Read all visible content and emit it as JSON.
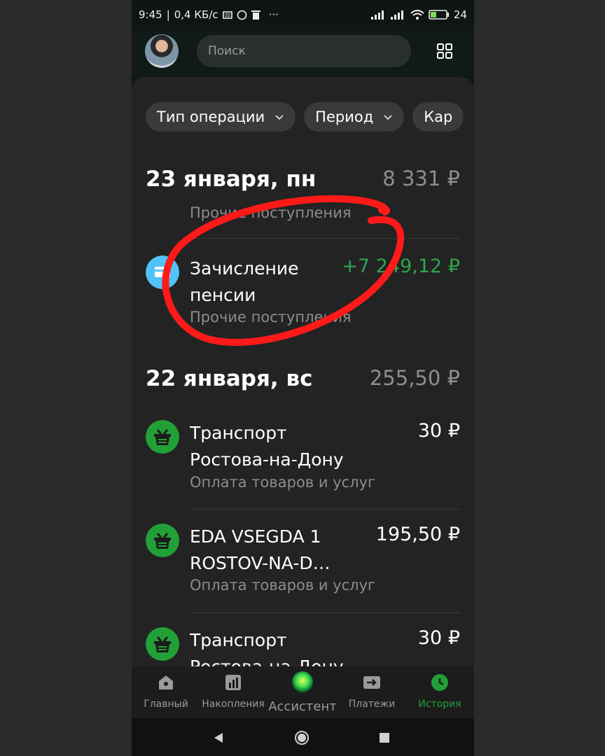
{
  "status_bar": {
    "time": "9:45",
    "speed": "0,4 КБ/с",
    "more": "···",
    "battery": "24"
  },
  "search": {
    "placeholder": "Поиск"
  },
  "filters": [
    "Тип операции",
    "Период",
    "Кар"
  ],
  "days": [
    {
      "title": "23 января, пн",
      "sum": "8 331 ₽",
      "truncated_category": "Прочие поступления",
      "transactions": [
        {
          "name": "Зачисление пенсии",
          "amount": "+7 249,12 ₽",
          "category": "Прочие поступления",
          "icon": "card-icon"
        }
      ]
    },
    {
      "title": "22 января, вс",
      "sum": "255,50 ₽",
      "transactions": [
        {
          "name": "Транспорт Ростова-на-Дону",
          "amount": "30 ₽",
          "category": "Оплата товаров и услуг",
          "icon": "basket-icon"
        },
        {
          "name": "EDA VSEGDA 1 ROSTOV-NA-D…",
          "amount": "195,50 ₽",
          "category": "Оплата товаров и услуг",
          "icon": "basket-icon"
        },
        {
          "name": "Транспорт Ростова-на-Дону",
          "amount": "30 ₽",
          "category": "",
          "icon": "basket-icon"
        }
      ]
    }
  ],
  "nav": [
    {
      "label": "Главный",
      "icon": "home-icon"
    },
    {
      "label": "Накопления",
      "icon": "chart-icon"
    },
    {
      "label": "Ассистент",
      "icon": "assistant-orb-icon"
    },
    {
      "label": "Платежи",
      "icon": "transfer-icon"
    },
    {
      "label": "История",
      "icon": "clock-icon",
      "active": true
    }
  ],
  "colors": {
    "accent": "#21a038",
    "income": "#2ea44f",
    "annotation": "#ff1a1a",
    "card_icon": "#4fc3f7"
  }
}
